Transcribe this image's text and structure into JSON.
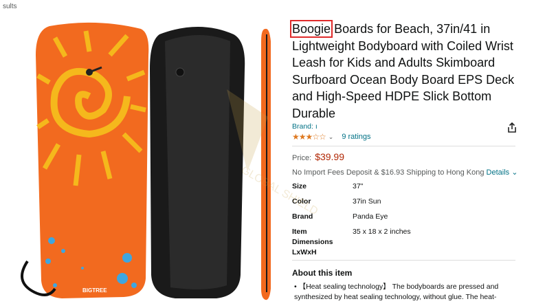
{
  "breadcrumb": "sults",
  "product": {
    "brand_word": "Boogie",
    "title_rest": " Boards for Beach, 37in/41 in Lightweight Bodyboard with Coiled Wrist Leash for Kids and Adults Skimboard Surfboard Ocean Body Board EPS Deck and High-Speed HDPE Slick Bottom Durable",
    "brand_label": "Brand: ı",
    "stars": "★★★☆☆",
    "ratings": "9 ratings",
    "price_label": "Price:",
    "price": "$39.99",
    "shipping": "No Import Fees Deposit & $16.93 Shipping to Hong Kong",
    "shipping_link": "Details",
    "specs": [
      {
        "key": "Size",
        "value": "37\""
      },
      {
        "key": "Color",
        "value": "37in Sun"
      },
      {
        "key": "Brand",
        "value": "Panda Eye"
      },
      {
        "key": "Item Dimensions LxWxH",
        "value": "35 x 18 x 2 inches"
      }
    ],
    "about_heading": "About this item",
    "bullet1": "【Heat sealing technology】 The bodyboards are pressed and synthesized by heat sealing technology, without glue. The heat-"
  },
  "image": {
    "board_logo": "BIGTREE",
    "watermark": "GLOBAL SHIELD"
  },
  "colors": {
    "board_orange": "#f26a1f",
    "board_yellow": "#f5b81c",
    "board_black": "#1a1a1a",
    "price_red": "#b12704",
    "link_teal": "#007185",
    "star_orange": "#de7921"
  }
}
